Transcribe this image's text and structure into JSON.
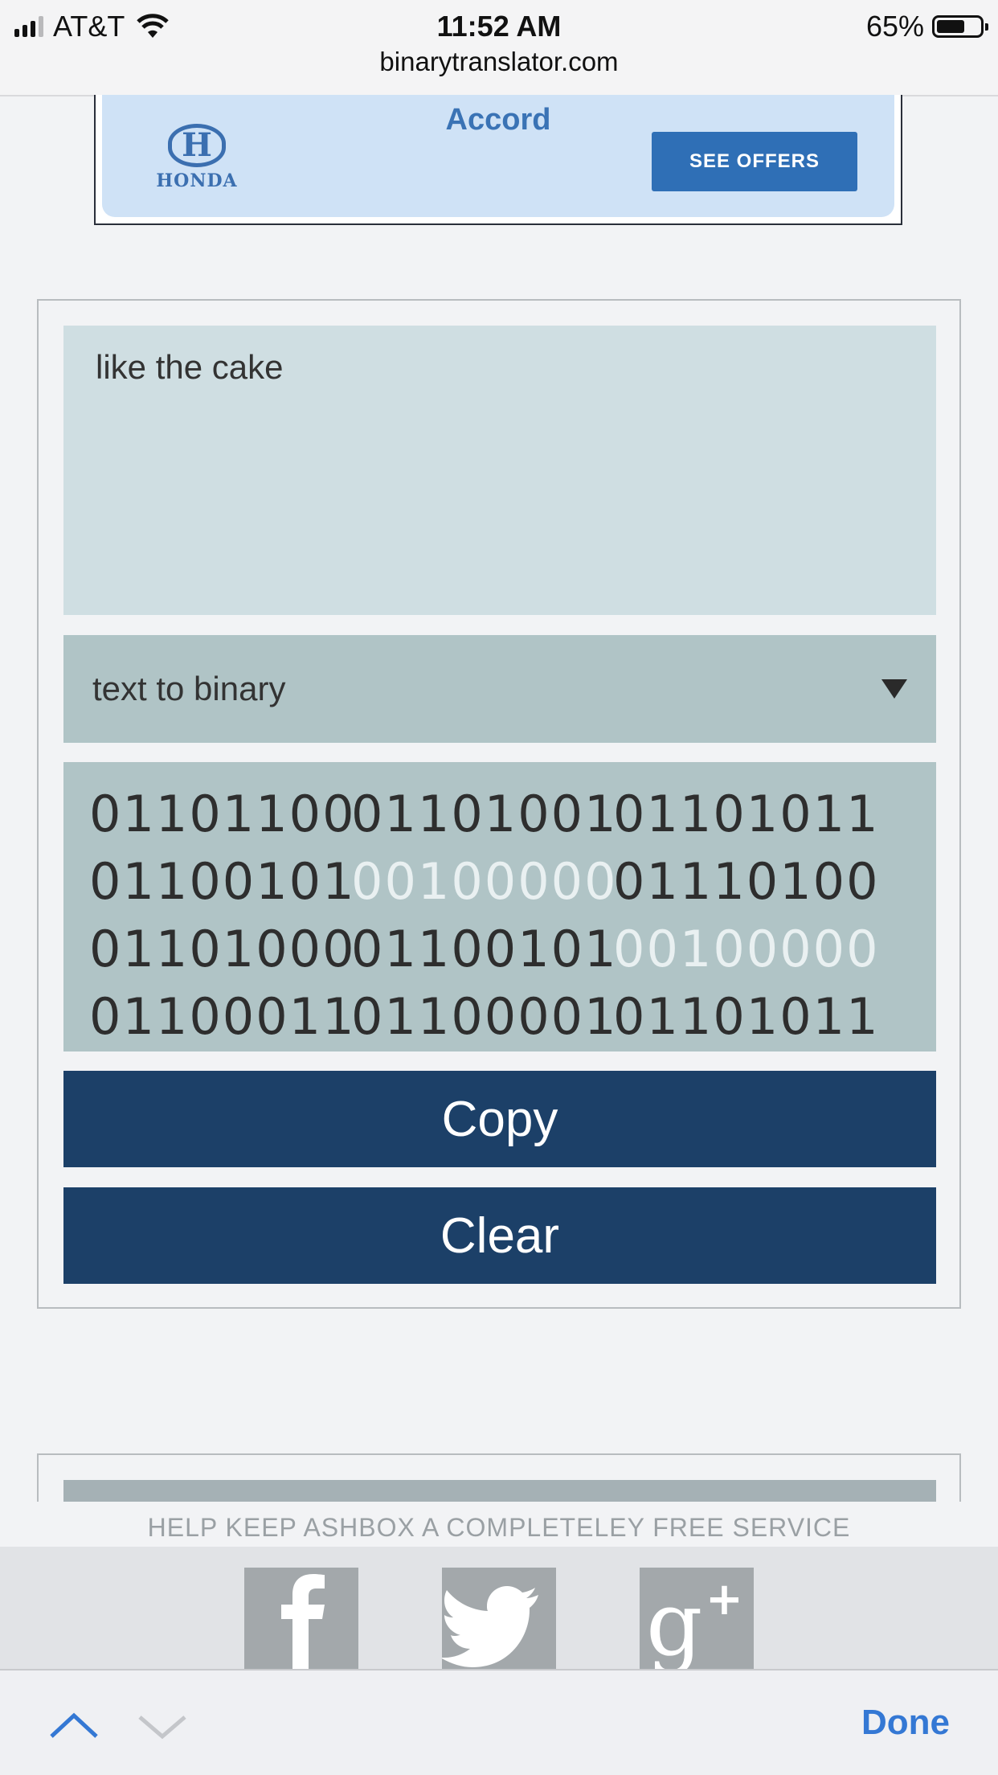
{
  "status_bar": {
    "carrier": "AT&T",
    "time": "11:52 AM",
    "battery": "65%",
    "battery_level": 0.65,
    "url": "binarytranslator.com"
  },
  "ad": {
    "brand": "HONDA",
    "model": "Accord",
    "cta": "SEE OFFERS"
  },
  "translator": {
    "input_text": "like the cake",
    "mode": "text to binary",
    "output_rows": [
      [
        {
          "v": "01101100",
          "light": false
        },
        {
          "v": "01101001",
          "light": false
        },
        {
          "v": "01101011",
          "light": false
        }
      ],
      [
        {
          "v": "01100101",
          "light": false
        },
        {
          "v": "00100000",
          "light": true
        },
        {
          "v": "01110100",
          "light": false
        }
      ],
      [
        {
          "v": "01101000",
          "light": false
        },
        {
          "v": "01100101",
          "light": false
        },
        {
          "v": "00100000",
          "light": true
        }
      ],
      [
        {
          "v": "01100011",
          "light": false
        },
        {
          "v": "01100001",
          "light": false
        },
        {
          "v": "01101011",
          "light": false
        }
      ]
    ],
    "copy_label": "Copy",
    "clear_label": "Clear"
  },
  "footer": {
    "support_text": "HELP KEEP ASHBOX A COMPLETELEY FREE SERVICE",
    "social": [
      "facebook-icon",
      "twitter-icon",
      "google-plus-icon"
    ]
  },
  "toolbar": {
    "done_label": "Done"
  }
}
